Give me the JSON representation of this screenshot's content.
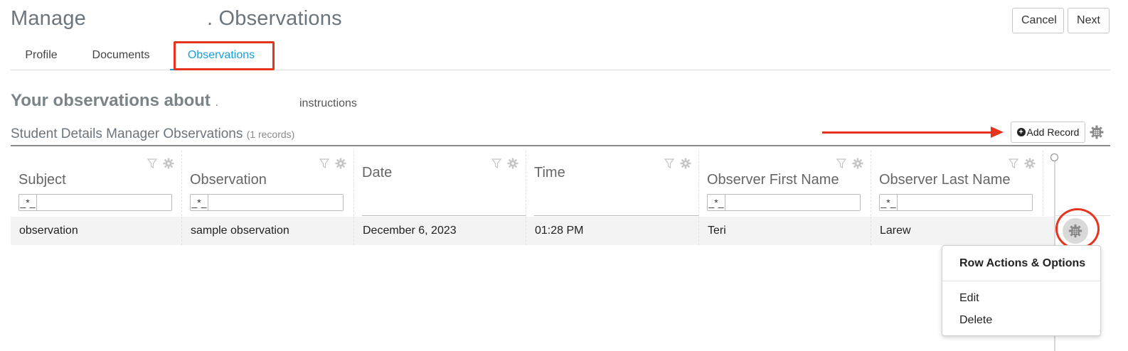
{
  "header": {
    "title_prefix": "Manage",
    "title_suffix": ". Observations",
    "cancel_label": "Cancel",
    "next_label": "Next"
  },
  "tabs": [
    {
      "label": "Profile"
    },
    {
      "label": "Documents"
    },
    {
      "label": "Observations",
      "active": true
    }
  ],
  "observations": {
    "heading": "Your observations about",
    "heading_suffix": ".",
    "instructions": "instructions"
  },
  "section": {
    "title": "Student Details Manager Observations",
    "count": "(1 records)",
    "add_label": "Add Record",
    "add_icon": "plus-circle-icon"
  },
  "table": {
    "filter_operator": "_*_",
    "columns": [
      {
        "label": "Subject"
      },
      {
        "label": "Observation"
      },
      {
        "label": "Date"
      },
      {
        "label": "Time"
      },
      {
        "label": "Observer First Name"
      },
      {
        "label": "Observer Last Name"
      }
    ],
    "rows": [
      [
        "observation",
        "sample observation",
        "December 6, 2023",
        "01:28 PM",
        "Teri",
        "Larew"
      ]
    ]
  },
  "row_menu": {
    "title": "Row Actions & Options",
    "items": [
      "Edit",
      "Delete"
    ]
  },
  "colors": {
    "accent": "#1a9ed8",
    "annotation": "#e5331e",
    "muted_text": "#6b757d"
  }
}
